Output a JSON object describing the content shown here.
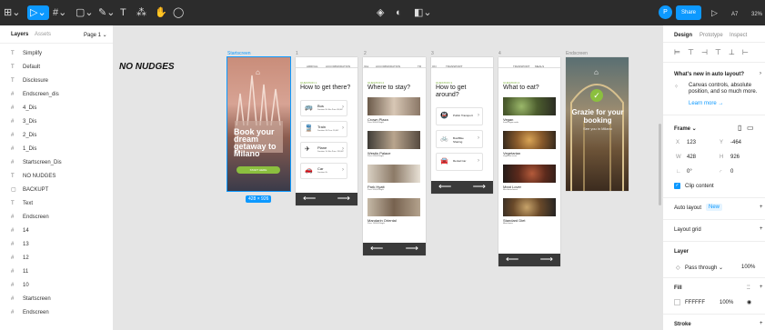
{
  "toolbar": {
    "menu": "⊞⌄",
    "move": "▷⌄",
    "frame": "#⌄",
    "rect": "▢⌄",
    "pen": "✎⌄",
    "text": "T",
    "components": "⁂",
    "hand": "✋",
    "comment": "◯",
    "center1": "◈",
    "center2": "◐",
    "center3": "◧⌄",
    "avatar": "P",
    "share": "Share",
    "play": "▷",
    "aa": "A7",
    "zoom": "32%"
  },
  "left": {
    "tab_layers": "Layers",
    "tab_assets": "Assets",
    "page": "Page 1 ⌄",
    "layers": [
      {
        "icon": "T",
        "label": "Simplify"
      },
      {
        "icon": "T",
        "label": "Default"
      },
      {
        "icon": "T",
        "label": "Disclosure"
      },
      {
        "icon": "#",
        "label": "Endscreen_dis"
      },
      {
        "icon": "#",
        "label": "4_Dis"
      },
      {
        "icon": "#",
        "label": "3_Dis"
      },
      {
        "icon": "#",
        "label": "2_Dis"
      },
      {
        "icon": "#",
        "label": "1_Dis"
      },
      {
        "icon": "#",
        "label": "Startscreen_Dis"
      },
      {
        "icon": "T",
        "label": "NO NUDGES"
      },
      {
        "icon": "▢",
        "label": "BACKUPT"
      },
      {
        "icon": "T",
        "label": "Text"
      },
      {
        "icon": "#",
        "label": "Endscreen"
      },
      {
        "icon": "#",
        "label": "14"
      },
      {
        "icon": "#",
        "label": "13"
      },
      {
        "icon": "#",
        "label": "12"
      },
      {
        "icon": "#",
        "label": "11"
      },
      {
        "icon": "#",
        "label": "10"
      },
      {
        "icon": "#",
        "label": "Startscreen"
      },
      {
        "icon": "#",
        "label": "Endscreen"
      }
    ]
  },
  "canvas": {
    "heading": "NO NUDGES",
    "frame_labels": [
      "Startscreen",
      "1",
      "2",
      "3",
      "4",
      "Endscreen"
    ],
    "size_badge": "428 × 926",
    "start": {
      "title": "Book your dream getaway to Milano",
      "button": "START HERE"
    },
    "end": {
      "title": "Grazie for your booking",
      "sub": "See you in Milano"
    },
    "s1": {
      "tabs": [
        "ARRIVAL",
        "ACCOMMODATION"
      ],
      "question": "QUESTION 1",
      "title": "How to get there?",
      "options": [
        {
          "icon": "🚌",
          "label": "Bus",
          "desc": "Duration: 8h 30m  Price: 86,00€"
        },
        {
          "icon": "🚆",
          "label": "Train",
          "desc": "Duration: 4h  Price: 99,00€"
        },
        {
          "icon": "✈",
          "label": "Plane",
          "desc": "Duration: 1h 30m  Price: 120,00€"
        },
        {
          "icon": "🚗",
          "label": "Car",
          "desc": "Duration: 6h"
        }
      ]
    },
    "s2": {
      "tabs": [
        "VAL",
        "ACCOMMODATION",
        "TR"
      ],
      "question": "QUESTION 2",
      "title": "Where to stay?",
      "hotels": [
        {
          "name": "Crown Plaza",
          "desc": "Price: 800,00€/night"
        },
        {
          "name": "Westin Palace",
          "desc": "Price: 620,00€/night"
        },
        {
          "name": "Park Hyatt",
          "desc": "Price: 900,00€/night"
        },
        {
          "name": "Mandarin Oriental",
          "desc": "Price: 1100,00€/night"
        }
      ]
    },
    "s3": {
      "tabs": [
        "ON",
        "TRANSPORT"
      ],
      "question": "QUESTION 3",
      "title": "How to get around?",
      "options": [
        {
          "icon": "🚇",
          "label": "Public Transport"
        },
        {
          "icon": "🚲",
          "label": "Bus/Bike Sharing"
        },
        {
          "icon": "🚘",
          "label": "Rental Car"
        }
      ]
    },
    "s4": {
      "tabs": [
        "TRANSPORT",
        "MEALS"
      ],
      "question": "QUESTION 4",
      "title": "What to eat?",
      "foods": [
        {
          "name": "Vegan",
          "desc": "Fresh vegan meals"
        },
        {
          "name": "Vegetarian",
          "desc": "Vegetarian menu"
        },
        {
          "name": "Meat Lover",
          "desc": "Meat based menu"
        },
        {
          "name": "Standard Diet",
          "desc": "Mixed menu"
        }
      ]
    },
    "arrow_left": "⟵",
    "arrow_right": "⟶"
  },
  "right": {
    "tab_design": "Design",
    "tab_proto": "Prototype",
    "tab_inspect": "Inspect",
    "whats_new": "What's new in auto layout?",
    "whats_body": "Canvas controls, absolute position, and so much more.",
    "learn": "Learn more →",
    "frame": "Frame ⌄",
    "x_label": "X",
    "x": "123",
    "y_label": "Y",
    "y": "-464",
    "w_label": "W",
    "w": "428",
    "h_label": "H",
    "h": "926",
    "r_label": "∟",
    "r": "0°",
    "c_label": "◜",
    "c": "0",
    "clip": "Clip content",
    "auto_layout": "Auto layout",
    "new_badge": "New",
    "layout_grid": "Layout grid",
    "layer": "Layer",
    "pass": "Pass through ⌄",
    "opacity": "100%",
    "fill": "Fill",
    "fill_hex": "FFFFFF",
    "fill_op": "100%",
    "stroke": "Stroke"
  }
}
